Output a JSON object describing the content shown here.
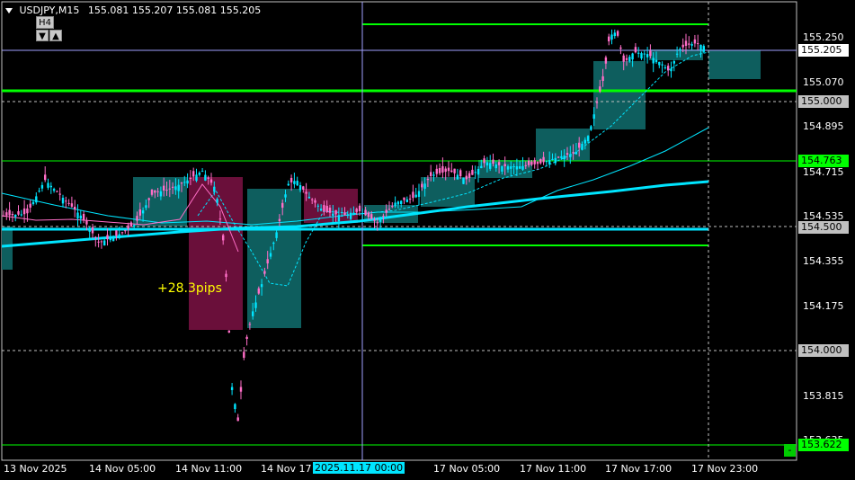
{
  "header": {
    "symbol_tf": "USDJPY,M15",
    "ohlc": "155.081 155.207 155.081 155.205"
  },
  "timeframe_button": {
    "label": "H4"
  },
  "price_axis": {
    "ticks": [
      "155.250",
      "155.070",
      "154.895",
      "154.715",
      "154.535",
      "154.355",
      "154.175",
      "153.815",
      "153.635"
    ],
    "labels": {
      "bid": "155.205",
      "level_155000": "155.000",
      "level_154763": "154.763",
      "level_154500": "154.500",
      "level_154000": "154.000",
      "level_153622": "153.622"
    }
  },
  "time_axis": {
    "labels": [
      "13 Nov 2025",
      "14 Nov 05:00",
      "14 Nov 11:00",
      "14 Nov 17",
      "17 Nov 05:00",
      "17 Nov 11:00",
      "17 Nov 17:00",
      "17 Nov 23:00"
    ],
    "highlight": "2025.11.17 00:00"
  },
  "annotation": {
    "pips": "+28.3pips"
  },
  "controls": {
    "minus": "-"
  },
  "colors": {
    "background": "#000000",
    "bull_candle": "#00e5ff",
    "bear_candle": "#ff6ec7",
    "teal_box": "#0e5e5e",
    "maroon_box": "#6a0f3a",
    "green_line": "#00ff00",
    "bid_label_bg": "#ffffff",
    "level_label_bg": "#c0c0c0",
    "green_label_bg": "#00ff00"
  }
}
